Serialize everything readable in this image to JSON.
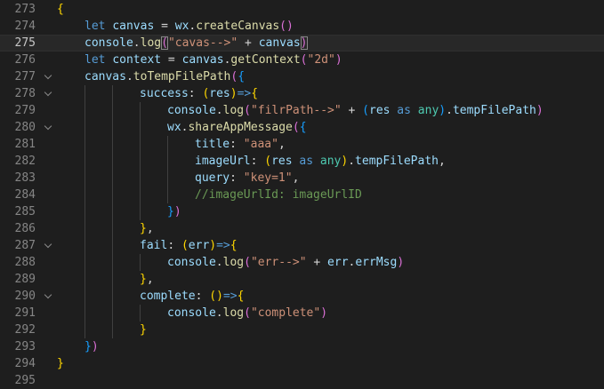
{
  "editor": {
    "current_line": 275,
    "lines": [
      {
        "number": "273",
        "indent": 0,
        "fold": false,
        "tokens": [
          {
            "t": "{",
            "c": "b1"
          }
        ]
      },
      {
        "number": "274",
        "indent": 1,
        "fold": false,
        "tokens": [
          {
            "t": "let ",
            "c": "kw"
          },
          {
            "t": "canvas",
            "c": "var"
          },
          {
            "t": " = ",
            "c": "op"
          },
          {
            "t": "wx",
            "c": "var"
          },
          {
            "t": ".",
            "c": "op"
          },
          {
            "t": "createCanvas",
            "c": "fn"
          },
          {
            "t": "()",
            "c": "b2"
          }
        ]
      },
      {
        "number": "275",
        "indent": 1,
        "fold": false,
        "tokens": [
          {
            "t": "console",
            "c": "var"
          },
          {
            "t": ".",
            "c": "op"
          },
          {
            "t": "log",
            "c": "fn"
          },
          {
            "t": "(",
            "c": "b2",
            "m": true
          },
          {
            "t": "\"cavas-->\"",
            "c": "str"
          },
          {
            "t": " + ",
            "c": "op"
          },
          {
            "t": "canvas",
            "c": "var"
          },
          {
            "t": ")",
            "c": "b2",
            "m": true
          }
        ]
      },
      {
        "number": "276",
        "indent": 1,
        "fold": false,
        "tokens": [
          {
            "t": "let ",
            "c": "kw"
          },
          {
            "t": "context",
            "c": "var"
          },
          {
            "t": " = ",
            "c": "op"
          },
          {
            "t": "canvas",
            "c": "var"
          },
          {
            "t": ".",
            "c": "op"
          },
          {
            "t": "getContext",
            "c": "fn"
          },
          {
            "t": "(",
            "c": "b2"
          },
          {
            "t": "\"2d\"",
            "c": "str"
          },
          {
            "t": ")",
            "c": "b2"
          }
        ]
      },
      {
        "number": "277",
        "indent": 1,
        "fold": true,
        "tokens": [
          {
            "t": "canvas",
            "c": "var"
          },
          {
            "t": ".",
            "c": "op"
          },
          {
            "t": "toTempFilePath",
            "c": "fn"
          },
          {
            "t": "(",
            "c": "b2"
          },
          {
            "t": "{",
            "c": "b3"
          }
        ]
      },
      {
        "number": "278",
        "indent": 3,
        "fold": true,
        "tokens": [
          {
            "t": "success",
            "c": "var"
          },
          {
            "t": ": ",
            "c": "op"
          },
          {
            "t": "(",
            "c": "b1"
          },
          {
            "t": "res",
            "c": "var"
          },
          {
            "t": ")",
            "c": "b1"
          },
          {
            "t": "=>",
            "c": "kw"
          },
          {
            "t": "{",
            "c": "b1"
          }
        ]
      },
      {
        "number": "279",
        "indent": 4,
        "fold": false,
        "tokens": [
          {
            "t": "console",
            "c": "var"
          },
          {
            "t": ".",
            "c": "op"
          },
          {
            "t": "log",
            "c": "fn"
          },
          {
            "t": "(",
            "c": "b2"
          },
          {
            "t": "\"filrPath-->\"",
            "c": "str"
          },
          {
            "t": " + ",
            "c": "op"
          },
          {
            "t": "(",
            "c": "b3"
          },
          {
            "t": "res",
            "c": "var"
          },
          {
            "t": " as ",
            "c": "kw"
          },
          {
            "t": "any",
            "c": "type"
          },
          {
            "t": ")",
            "c": "b3"
          },
          {
            "t": ".",
            "c": "op"
          },
          {
            "t": "tempFilePath",
            "c": "var"
          },
          {
            "t": ")",
            "c": "b2"
          }
        ]
      },
      {
        "number": "280",
        "indent": 4,
        "fold": true,
        "tokens": [
          {
            "t": "wx",
            "c": "var"
          },
          {
            "t": ".",
            "c": "op"
          },
          {
            "t": "shareAppMessage",
            "c": "fn"
          },
          {
            "t": "(",
            "c": "b2"
          },
          {
            "t": "{",
            "c": "b3"
          }
        ]
      },
      {
        "number": "281",
        "indent": 5,
        "fold": false,
        "tokens": [
          {
            "t": "title",
            "c": "var"
          },
          {
            "t": ": ",
            "c": "op"
          },
          {
            "t": "\"aaa\"",
            "c": "str"
          },
          {
            "t": ",",
            "c": "op"
          }
        ]
      },
      {
        "number": "282",
        "indent": 5,
        "fold": false,
        "tokens": [
          {
            "t": "imageUrl",
            "c": "var"
          },
          {
            "t": ": ",
            "c": "op"
          },
          {
            "t": "(",
            "c": "b1"
          },
          {
            "t": "res",
            "c": "var"
          },
          {
            "t": " as ",
            "c": "kw"
          },
          {
            "t": "any",
            "c": "type"
          },
          {
            "t": ")",
            "c": "b1"
          },
          {
            "t": ".",
            "c": "op"
          },
          {
            "t": "tempFilePath",
            "c": "var"
          },
          {
            "t": ",",
            "c": "op"
          }
        ]
      },
      {
        "number": "283",
        "indent": 5,
        "fold": false,
        "tokens": [
          {
            "t": "query",
            "c": "var"
          },
          {
            "t": ": ",
            "c": "op"
          },
          {
            "t": "\"key=1\"",
            "c": "str"
          },
          {
            "t": ",",
            "c": "op"
          }
        ]
      },
      {
        "number": "284",
        "indent": 5,
        "fold": false,
        "tokens": [
          {
            "t": "//imageUrlId: imageUrlID",
            "c": "cm"
          }
        ]
      },
      {
        "number": "285",
        "indent": 4,
        "fold": false,
        "tokens": [
          {
            "t": "}",
            "c": "b3"
          },
          {
            "t": ")",
            "c": "b2"
          }
        ]
      },
      {
        "number": "286",
        "indent": 3,
        "fold": false,
        "tokens": [
          {
            "t": "}",
            "c": "b1"
          },
          {
            "t": ",",
            "c": "op"
          }
        ]
      },
      {
        "number": "287",
        "indent": 3,
        "fold": true,
        "tokens": [
          {
            "t": "fail",
            "c": "var"
          },
          {
            "t": ": ",
            "c": "op"
          },
          {
            "t": "(",
            "c": "b1"
          },
          {
            "t": "err",
            "c": "var"
          },
          {
            "t": ")",
            "c": "b1"
          },
          {
            "t": "=>",
            "c": "kw"
          },
          {
            "t": "{",
            "c": "b1"
          }
        ]
      },
      {
        "number": "288",
        "indent": 4,
        "fold": false,
        "tokens": [
          {
            "t": "console",
            "c": "var"
          },
          {
            "t": ".",
            "c": "op"
          },
          {
            "t": "log",
            "c": "fn"
          },
          {
            "t": "(",
            "c": "b2"
          },
          {
            "t": "\"err-->\"",
            "c": "str"
          },
          {
            "t": " + ",
            "c": "op"
          },
          {
            "t": "err",
            "c": "var"
          },
          {
            "t": ".",
            "c": "op"
          },
          {
            "t": "errMsg",
            "c": "var"
          },
          {
            "t": ")",
            "c": "b2"
          }
        ]
      },
      {
        "number": "289",
        "indent": 3,
        "fold": false,
        "tokens": [
          {
            "t": "}",
            "c": "b1"
          },
          {
            "t": ",",
            "c": "op"
          }
        ]
      },
      {
        "number": "290",
        "indent": 3,
        "fold": true,
        "tokens": [
          {
            "t": "complete",
            "c": "var"
          },
          {
            "t": ": ",
            "c": "op"
          },
          {
            "t": "()",
            "c": "b1"
          },
          {
            "t": "=>",
            "c": "kw"
          },
          {
            "t": "{",
            "c": "b1"
          }
        ]
      },
      {
        "number": "291",
        "indent": 4,
        "fold": false,
        "tokens": [
          {
            "t": "console",
            "c": "var"
          },
          {
            "t": ".",
            "c": "op"
          },
          {
            "t": "log",
            "c": "fn"
          },
          {
            "t": "(",
            "c": "b2"
          },
          {
            "t": "\"complete\"",
            "c": "str"
          },
          {
            "t": ")",
            "c": "b2"
          }
        ]
      },
      {
        "number": "292",
        "indent": 3,
        "fold": false,
        "tokens": [
          {
            "t": "}",
            "c": "b1"
          }
        ]
      },
      {
        "number": "293",
        "indent": 1,
        "fold": false,
        "tokens": [
          {
            "t": "}",
            "c": "b3"
          },
          {
            "t": ")",
            "c": "b2"
          }
        ]
      },
      {
        "number": "294",
        "indent": 0,
        "fold": false,
        "tokens": [
          {
            "t": "}",
            "c": "b1"
          }
        ]
      },
      {
        "number": "295",
        "indent": 0,
        "fold": false,
        "tokens": []
      }
    ]
  }
}
